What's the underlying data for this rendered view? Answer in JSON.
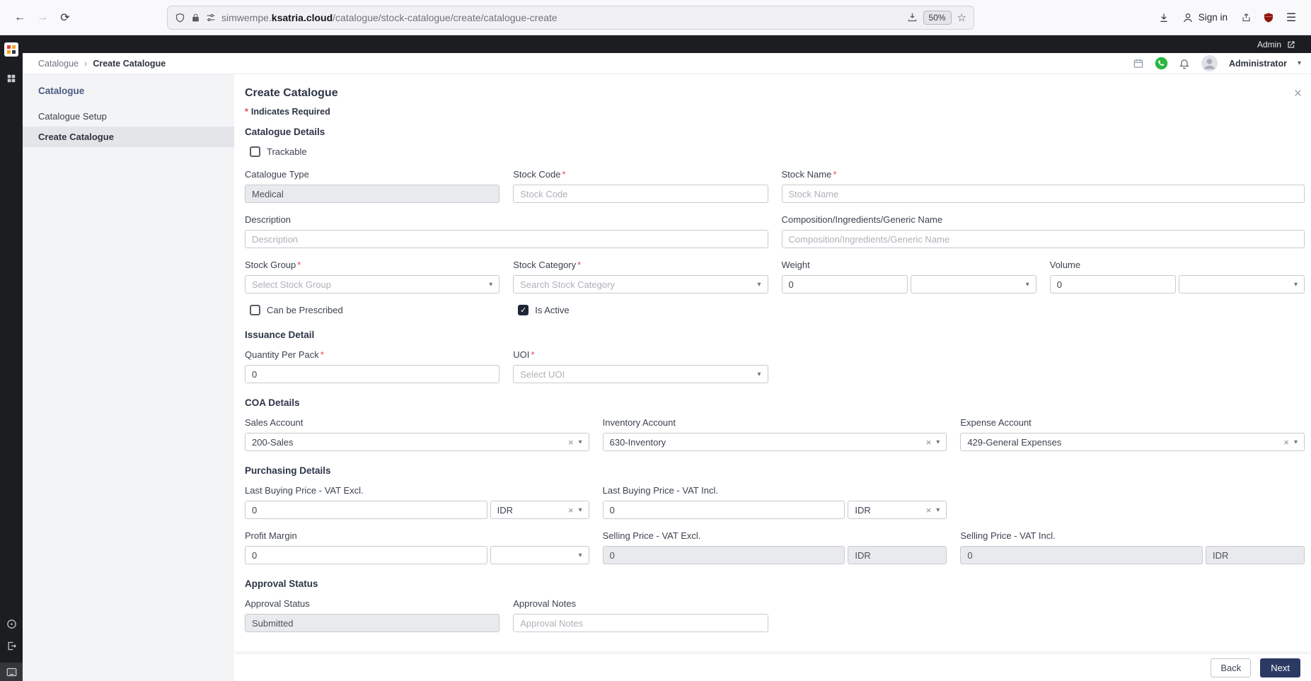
{
  "icons": {
    "back": "←",
    "forward": "→",
    "reload": "⟳",
    "star": "☆",
    "menu": "☰",
    "caret_down": "▾",
    "chevron_right": "›",
    "clear": "×",
    "close": "×",
    "check": "✓"
  },
  "browser": {
    "url": {
      "subdomain": "simwempe.",
      "domain": "ksatria.cloud",
      "path": "/catalogue/stock-catalogue/create/catalogue-create"
    },
    "zoom_badge": "50%",
    "signin_label": "Sign in"
  },
  "topbar": {
    "admin_label": "Admin"
  },
  "breadcrumb": {
    "crumb_parent": "Catalogue",
    "crumb_current": "Create Catalogue",
    "user_label": "Administrator"
  },
  "sidebar": {
    "heading": "Catalogue",
    "items": [
      {
        "label": "Catalogue Setup"
      },
      {
        "label": "Create Catalogue"
      }
    ]
  },
  "form": {
    "title": "Create Catalogue",
    "required_marker": "*",
    "required_note": "Indicates Required",
    "catalogue_details": {
      "heading": "Catalogue Details",
      "trackable_label": "Trackable",
      "catalogue_type": {
        "label": "Catalogue Type",
        "value": "Medical"
      },
      "stock_code": {
        "label": "Stock Code",
        "placeholder": "Stock Code"
      },
      "stock_name": {
        "label": "Stock Name",
        "placeholder": "Stock Name"
      },
      "description": {
        "label": "Description",
        "placeholder": "Description"
      },
      "composition": {
        "label": "Composition/Ingredients/Generic Name",
        "placeholder": "Composition/Ingredients/Generic Name"
      },
      "stock_group": {
        "label": "Stock Group",
        "placeholder": "Select Stock Group"
      },
      "stock_category": {
        "label": "Stock Category",
        "placeholder": "Search Stock Category"
      },
      "weight": {
        "label": "Weight",
        "value": "0"
      },
      "volume": {
        "label": "Volume",
        "value": "0"
      },
      "can_be_prescribed_label": "Can be Prescribed",
      "is_active_label": "Is Active"
    },
    "issuance_detail": {
      "heading": "Issuance Detail",
      "quantity_per_pack": {
        "label": "Quantity Per Pack",
        "value": "0"
      },
      "uoi": {
        "label": "UOI",
        "placeholder": "Select UOI"
      }
    },
    "coa_details": {
      "heading": "COA Details",
      "sales_account": {
        "label": "Sales Account",
        "value": "200-Sales"
      },
      "inventory_account": {
        "label": "Inventory Account",
        "value": "630-Inventory"
      },
      "expense_account": {
        "label": "Expense Account",
        "value": "429-General Expenses"
      }
    },
    "purchasing_details": {
      "heading": "Purchasing Details",
      "last_buying_excl": {
        "label": "Last Buying Price - VAT Excl.",
        "value": "0",
        "currency": "IDR"
      },
      "last_buying_incl": {
        "label": "Last Buying Price - VAT Incl.",
        "value": "0",
        "currency": "IDR"
      },
      "profit_margin": {
        "label": "Profit Margin",
        "value": "0"
      },
      "selling_excl": {
        "label": "Selling Price - VAT Excl.",
        "value": "0",
        "currency": "IDR"
      },
      "selling_incl": {
        "label": "Selling Price - VAT Incl.",
        "value": "0",
        "currency": "IDR"
      }
    },
    "approval": {
      "heading": "Approval Status",
      "approval_status": {
        "label": "Approval Status",
        "value": "Submitted"
      },
      "approval_notes": {
        "label": "Approval Notes",
        "placeholder": "Approval Notes"
      }
    }
  },
  "footer": {
    "back_label": "Back",
    "next_label": "Next"
  }
}
